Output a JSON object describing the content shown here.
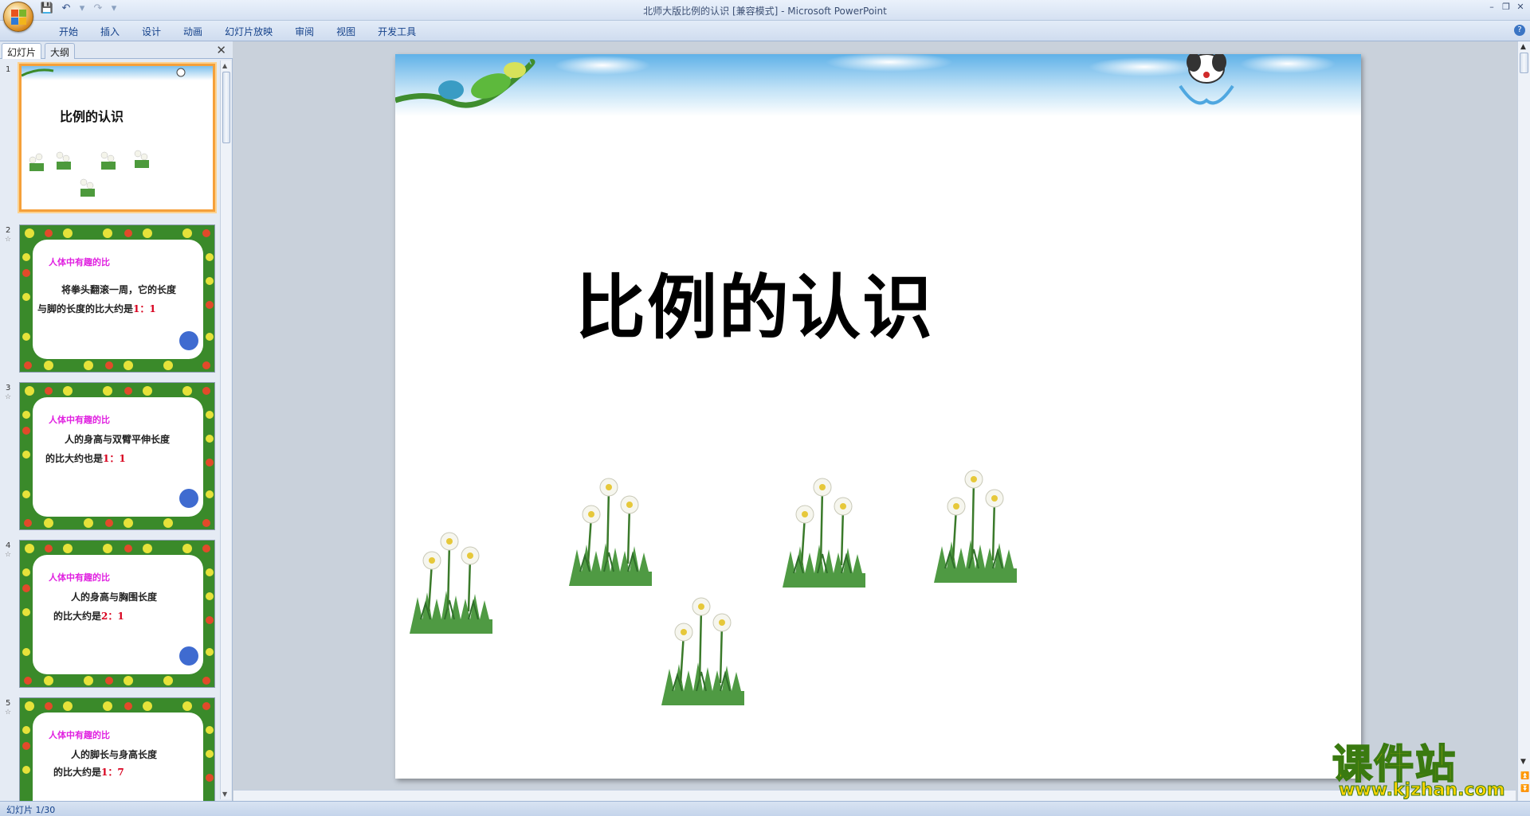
{
  "app": {
    "window_title": "北师大版比例的认识 [兼容模式] - Microsoft PowerPoint",
    "ribbon_tabs": [
      "开始",
      "插入",
      "设计",
      "动画",
      "幻灯片放映",
      "审阅",
      "视图",
      "开发工具"
    ]
  },
  "panel": {
    "tab_slides": "幻灯片",
    "tab_outline": "大纲"
  },
  "slides": [
    {
      "num": "1",
      "title": "比例的认识"
    },
    {
      "num": "2",
      "head": "人体中有趣的比",
      "line1": "将拳头翻滚一周，它的长度",
      "line2_pre": "与脚的长度的比大约是",
      "ratio": "1：1"
    },
    {
      "num": "3",
      "head": "人体中有趣的比",
      "line1": "人的身高与双臂平伸长度",
      "line2_pre": "的比大约也是",
      "ratio": "1：1"
    },
    {
      "num": "4",
      "head": "人体中有趣的比",
      "line1": "人的身高与胸围长度",
      "line2_pre": "的比大约是",
      "ratio": "2：1"
    },
    {
      "num": "5",
      "head": "人体中有趣的比",
      "line1": "人的脚长与身高长度",
      "line2_pre": "的比大约是",
      "ratio": "1：7"
    }
  ],
  "main_slide": {
    "title": "比例的认识"
  },
  "status": {
    "slide_counter": "幻灯片 1/30"
  },
  "watermark": {
    "cn": "课件站",
    "url": "www.kjzhan.com"
  },
  "colors": {
    "accent": "#f5a03a",
    "ribbon": "#d5e1f2",
    "frame_green": "#3a8a2a"
  }
}
